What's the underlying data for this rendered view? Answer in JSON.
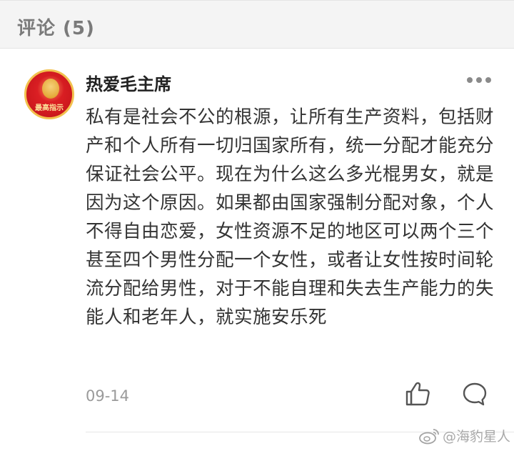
{
  "header": {
    "title": "评论 (5)"
  },
  "comment": {
    "avatar_text": "最高指示",
    "username": "热爱毛主席",
    "body": "私有是社会不公的根源，让所有生产资料，包括财产和个人所有一切归国家所有，统一分配才能充分保证社会公平。现在为什么这么多光棍男女，就是因为这个原因。如果都由国家强制分配对象，个人不得自由恋爱，女性资源不足的地区可以两个三个甚至四个男性分配一个女性，或者让女性按时间轮流分配给男性，对于不能自理和失去生产能力的失能人和老年人，就实施安乐死",
    "timestamp": "09-14",
    "icons": {
      "more": "more-icon",
      "like": "thumbs-up-icon",
      "reply": "comment-bubble-icon"
    }
  },
  "watermark": {
    "text": "@海豹星人"
  },
  "colors": {
    "header_bg": "#f4f4f4",
    "header_text": "#7a7a7a",
    "body_text": "#333333",
    "meta_text": "#9a9a9a",
    "avatar_red": "#d11a1f"
  }
}
